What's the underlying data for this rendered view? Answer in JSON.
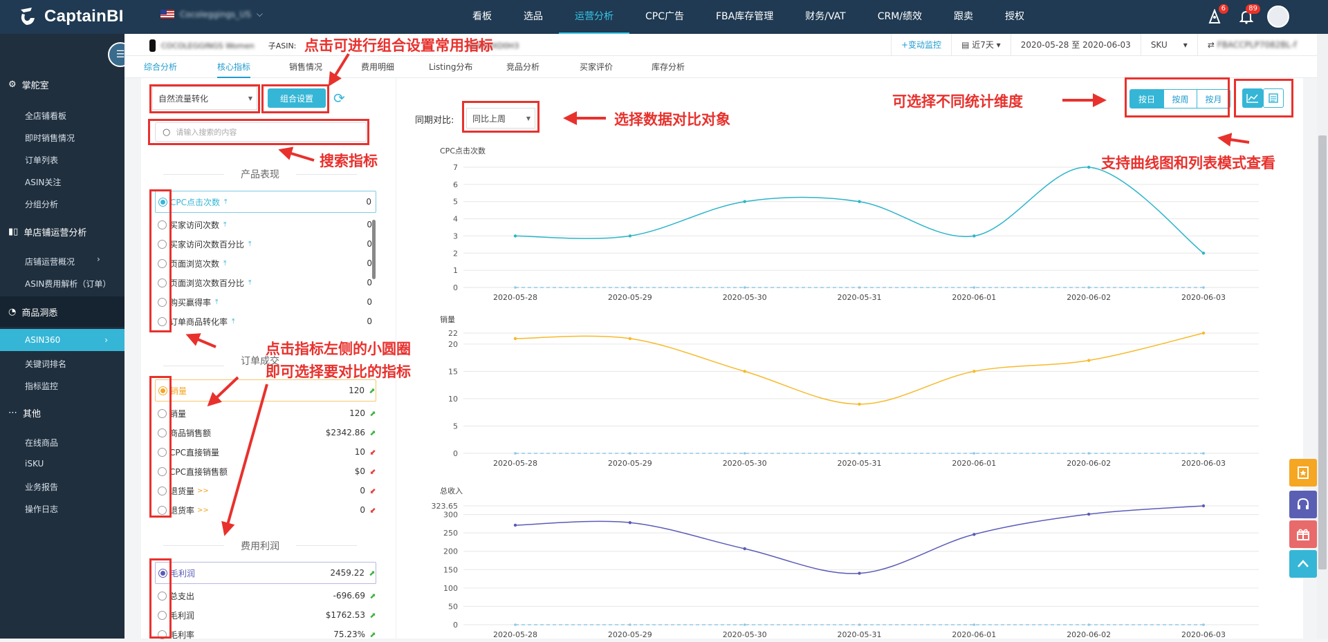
{
  "app": {
    "name": "CaptainBI"
  },
  "topbar": {
    "store": "Cocoleggings_US",
    "nav": [
      "看板",
      "选品",
      "运营分析",
      "CPC广告",
      "FBA库存管理",
      "财务/VAT",
      "CRM/绩效",
      "跟卖",
      "授权"
    ],
    "active_nav": "运营分析",
    "badges": {
      "alerts": "6",
      "notifications": "89"
    }
  },
  "sidebar": {
    "groups": [
      {
        "label": "掌舵室",
        "items": [
          "全店铺看板",
          "即时销售情况",
          "订单列表",
          "ASIN关注",
          "分组分析"
        ]
      },
      {
        "label": "单店铺运营分析",
        "items": [
          "店铺运营概况",
          "ASIN费用解析（订单）"
        ]
      },
      {
        "label": "商品洞悉",
        "items": [
          "ASIN360",
          "关键词排名",
          "指标监控"
        ]
      },
      {
        "label": "其他",
        "items": [
          "在线商品",
          "iSKU",
          "业务报告",
          "操作日志"
        ]
      }
    ]
  },
  "header": {
    "product_title": "COCOLEGGINGS Women",
    "child_asin_label": "子ASIN:",
    "child_asin": "B0823XD0H3",
    "monitor": "+变动监控",
    "range": "近7天",
    "dates": "2020-05-28 至 2020-06-03",
    "sku_label": "SKU",
    "sku": "FBACCPLP7082BL-f"
  },
  "tabs": [
    "综合分析",
    "核心指标",
    "销售情况",
    "费用明细",
    "Listing分布",
    "竞品分析",
    "买家评价",
    "库存分析"
  ],
  "controls": {
    "traffic_select": "自然流量转化",
    "combo_button": "组合设置",
    "search_placeholder": "请输入搜索的内容",
    "compare_label": "同期对比:",
    "compare_select": "同比上周",
    "periods": [
      "按日",
      "按周",
      "按月"
    ]
  },
  "sections": [
    {
      "title": "产品表现",
      "metrics": [
        {
          "label": "CPC点击次数",
          "value": "0"
        },
        {
          "label": "买家访问次数",
          "value": "0"
        },
        {
          "label": "买家访问次数百分比",
          "value": "0"
        },
        {
          "label": "页面浏览次数",
          "value": "0"
        },
        {
          "label": "页面浏览次数百分比",
          "value": "0"
        },
        {
          "label": "购买赢得率",
          "value": "0"
        },
        {
          "label": "订单商品转化率",
          "value": "0"
        }
      ]
    },
    {
      "title": "订单成交",
      "metrics": [
        {
          "label": "销量",
          "value": "120"
        },
        {
          "label": "销量",
          "value": "120"
        },
        {
          "label": "商品销售额",
          "value": "$2342.86"
        },
        {
          "label": "CPC直接销量",
          "value": "10"
        },
        {
          "label": "CPC直接销售额",
          "value": "$0"
        },
        {
          "label": "退货量",
          "value": "0"
        },
        {
          "label": "退货率",
          "value": "0"
        }
      ]
    },
    {
      "title": "费用利润",
      "metrics": [
        {
          "label": "毛利润",
          "value": "2459.22"
        },
        {
          "label": "总支出",
          "value": "-696.69"
        },
        {
          "label": "毛利润",
          "value": "$1762.53"
        },
        {
          "label": "毛利率",
          "value": "75.23%"
        }
      ]
    }
  ],
  "annotations": {
    "combo": "点击可进行组合设置常用指标",
    "search": "搜索指标",
    "radio1": "点击指标左侧的小圆圈",
    "radio2": "即可选择要对比的指标",
    "compare": "选择数据对比对象",
    "dimension": "可选择不同统计维度",
    "mode": "支持曲线图和列表模式查看"
  },
  "chart_data": [
    {
      "type": "line",
      "title": "CPC点击次数",
      "x": [
        "2020-05-28",
        "2020-05-29",
        "2020-05-30",
        "2020-05-31",
        "2020-06-01",
        "2020-06-02",
        "2020-06-03"
      ],
      "series": [
        {
          "values": [
            3,
            3,
            5,
            5,
            3,
            7,
            2
          ]
        },
        {
          "values": [
            0,
            0,
            0,
            0,
            0,
            0,
            0
          ]
        }
      ],
      "ylim": [
        0,
        7
      ],
      "yticks": [
        0,
        1,
        2,
        3,
        4,
        5,
        6,
        7
      ],
      "color": "#2bb5c9"
    },
    {
      "type": "line",
      "title": "销量",
      "x": [
        "2020-05-28",
        "2020-05-29",
        "2020-05-30",
        "2020-05-31",
        "2020-06-01",
        "2020-06-02",
        "2020-06-03"
      ],
      "series": [
        {
          "values": [
            21,
            21,
            15,
            9,
            15,
            17,
            22
          ]
        },
        {
          "values": [
            0,
            0,
            0,
            0,
            0,
            0,
            0
          ]
        }
      ],
      "ylim": [
        0,
        22
      ],
      "yticks": [
        0,
        5,
        10,
        15,
        20,
        22
      ],
      "color": "#f7b928"
    },
    {
      "type": "line",
      "title": "总收入",
      "x": [
        "2020-05-28",
        "2020-05-29",
        "2020-05-30",
        "2020-05-31",
        "2020-06-01",
        "2020-06-02",
        "2020-06-03"
      ],
      "series": [
        {
          "values": [
            271,
            278,
            207,
            140,
            246,
            301,
            323.65
          ]
        },
        {
          "values": [
            0,
            0,
            0,
            0,
            0,
            0,
            0
          ]
        }
      ],
      "ylim": [
        0,
        323.65
      ],
      "yticks": [
        0,
        50,
        100,
        150,
        200,
        250,
        300,
        323.65
      ],
      "color": "#5a5bb7"
    }
  ]
}
